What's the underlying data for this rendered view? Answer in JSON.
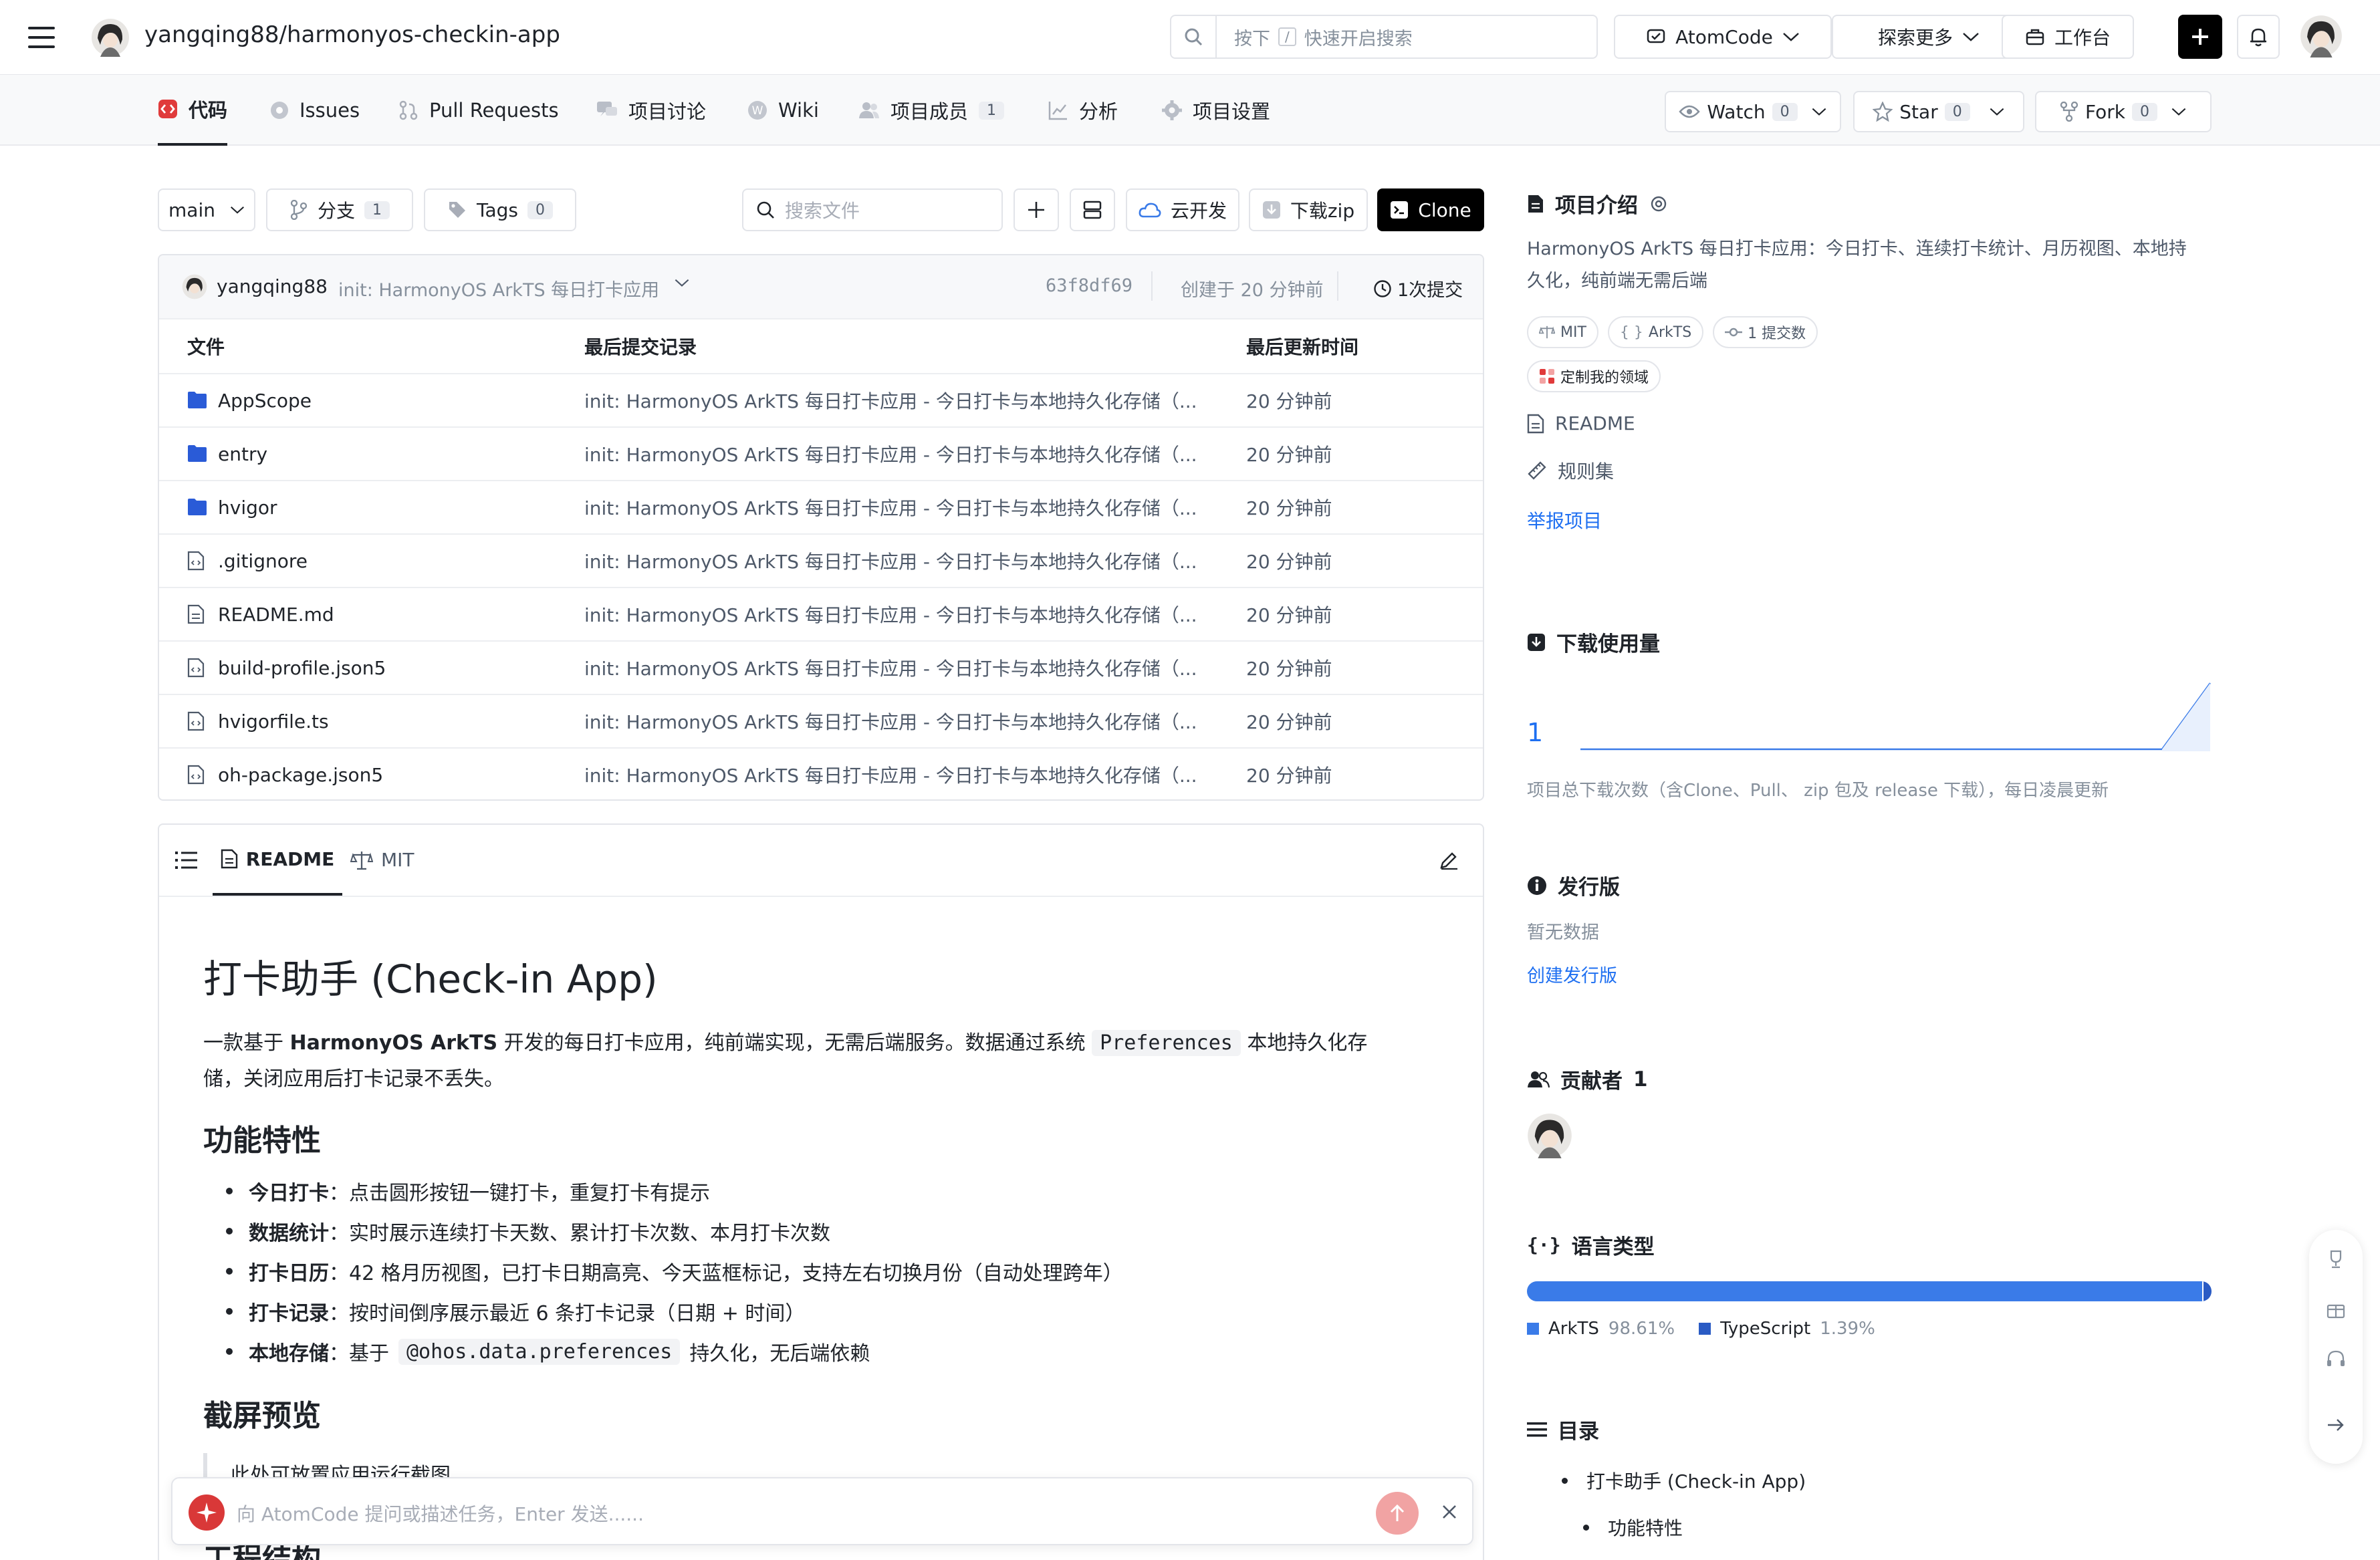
{
  "header": {
    "repo_path": "yangqing88/harmonyos-checkin-app",
    "search_prefix": "按下",
    "search_key": "/",
    "search_placeholder": "快速开启搜索",
    "atomcode_label": "AtomCode",
    "explore_label": "探索更多",
    "workbench_label": "工作台"
  },
  "subnav": {
    "tabs": [
      {
        "label": "代码",
        "count": ""
      },
      {
        "label": "Issues",
        "count": ""
      },
      {
        "label": "Pull Requests",
        "count": ""
      },
      {
        "label": "项目讨论",
        "count": ""
      },
      {
        "label": "Wiki",
        "count": ""
      },
      {
        "label": "项目成员",
        "count": "1"
      },
      {
        "label": "分析",
        "count": ""
      },
      {
        "label": "项目设置",
        "count": ""
      }
    ],
    "watch": {
      "label": "Watch",
      "count": "0"
    },
    "star": {
      "label": "Star",
      "count": "0"
    },
    "fork": {
      "label": "Fork",
      "count": "0"
    }
  },
  "toolbar": {
    "branch": "main",
    "branches_label": "分支",
    "branches_count": "1",
    "tags_label": "Tags",
    "tags_count": "0",
    "file_search_placeholder": "搜索文件",
    "cloud_dev_label": "云开发",
    "download_zip_label": "下载zip",
    "clone_label": "Clone"
  },
  "commit_bar": {
    "author": "yangqing88",
    "message": "init: HarmonyOS ArkTS 每日打卡应用",
    "hash": "63f8df69",
    "created": "创建于 20 分钟前",
    "commits": "1次提交"
  },
  "file_table": {
    "headers": [
      "文件",
      "最后提交记录",
      "最后更新时间"
    ],
    "rows": [
      {
        "name": "AppScope",
        "type": "folder",
        "commit": "init: HarmonyOS ArkTS 每日打卡应用 - 今日打卡与本地持久化存储（...",
        "time": "20 分钟前"
      },
      {
        "name": "entry",
        "type": "folder",
        "commit": "init: HarmonyOS ArkTS 每日打卡应用 - 今日打卡与本地持久化存储（...",
        "time": "20 分钟前"
      },
      {
        "name": "hvigor",
        "type": "folder",
        "commit": "init: HarmonyOS ArkTS 每日打卡应用 - 今日打卡与本地持久化存储（...",
        "time": "20 分钟前"
      },
      {
        "name": ".gitignore",
        "type": "code",
        "commit": "init: HarmonyOS ArkTS 每日打卡应用 - 今日打卡与本地持久化存储（...",
        "time": "20 分钟前"
      },
      {
        "name": "README.md",
        "type": "doc",
        "commit": "init: HarmonyOS ArkTS 每日打卡应用 - 今日打卡与本地持久化存储（...",
        "time": "20 分钟前"
      },
      {
        "name": "build-profile.json5",
        "type": "code",
        "commit": "init: HarmonyOS ArkTS 每日打卡应用 - 今日打卡与本地持久化存储（...",
        "time": "20 分钟前"
      },
      {
        "name": "hvigorfile.ts",
        "type": "code",
        "commit": "init: HarmonyOS ArkTS 每日打卡应用 - 今日打卡与本地持久化存储（...",
        "time": "20 分钟前"
      },
      {
        "name": "oh-package.json5",
        "type": "code",
        "commit": "init: HarmonyOS ArkTS 每日打卡应用 - 今日打卡与本地持久化存储（...",
        "time": "20 分钟前"
      }
    ]
  },
  "readme": {
    "tab_readme": "README",
    "tab_license": "MIT",
    "title": "打卡助手 (Check-in App)",
    "intro_1": "一款基于",
    "intro_bold": "HarmonyOS ArkTS",
    "intro_2": "开发的每日打卡应用，纯前端实现，无需后端服务。数据通过系统",
    "intro_code": "Preferences",
    "intro_3": "本地持久化存",
    "intro_line2": "储，关闭应用后打卡记录不丢失。",
    "features_heading": "功能特性",
    "features": [
      {
        "bold": "今日打卡",
        "text": "：点击圆形按钮一键打卡，重复打卡有提示"
      },
      {
        "bold": "数据统计",
        "text": "：实时展示连续打卡天数、累计打卡次数、本月打卡次数"
      },
      {
        "bold": "打卡日历",
        "text": "：42 格月历视图，已打卡日期高亮、今天蓝框标记，支持左右切换月份（自动处理跨年）"
      },
      {
        "bold": "打卡记录",
        "text": "：按时间倒序展示最近 6 条打卡记录（日期 + 时间）"
      },
      {
        "bold": "本地存储",
        "text": "：基于"
      }
    ],
    "storage_code": "@ohos.data.preferences",
    "storage_rest": "持久化，无后端依赖",
    "screens_heading": "截屏预览",
    "screens_quote": "此处可放置应用运行截图",
    "next_heading_partial": "工程结构"
  },
  "assistant": {
    "placeholder": "向 AtomCode 提问或描述任务，Enter 发送......"
  },
  "sidebar": {
    "intro_heading": "项目介绍",
    "intro_line1": "HarmonyOS ArkTS 每日打卡应用：今日打卡、连续打卡统计、月历视图、本地持",
    "intro_line2": "久化，纯前端无需后端",
    "tag_license": "MIT",
    "tag_lang": "ArkTS",
    "tag_commits": "1 提交数",
    "tag_domain": "定制我的领域",
    "readme_link": "README",
    "rules_link": "规则集",
    "report_link": "举报项目",
    "downloads_heading": "下载使用量",
    "downloads_count": "1",
    "downloads_note": "项目总下载次数（含Clone、Pull、 zip 包及 release 下载），每日凌晨更新",
    "release_heading": "发行版",
    "release_empty": "暂无数据",
    "release_create": "创建发行版",
    "contributors_heading": "贡献者",
    "contributors_count": "1",
    "languages_heading": "语言类型",
    "languages": [
      {
        "name": "ArkTS",
        "percent": "98.61%",
        "color": "#3a7be8",
        "fraction": 0.9861
      },
      {
        "name": "TypeScript",
        "percent": "1.39%",
        "color": "#2a5bc4",
        "fraction": 0.0139
      }
    ],
    "toc_heading": "目录",
    "toc": [
      "打卡助手 (Check-in App)",
      "功能特性"
    ]
  },
  "colors": {
    "accent": "#1e6ff1",
    "code_tab": "#e03b3b",
    "clone_bg": "#000000"
  }
}
